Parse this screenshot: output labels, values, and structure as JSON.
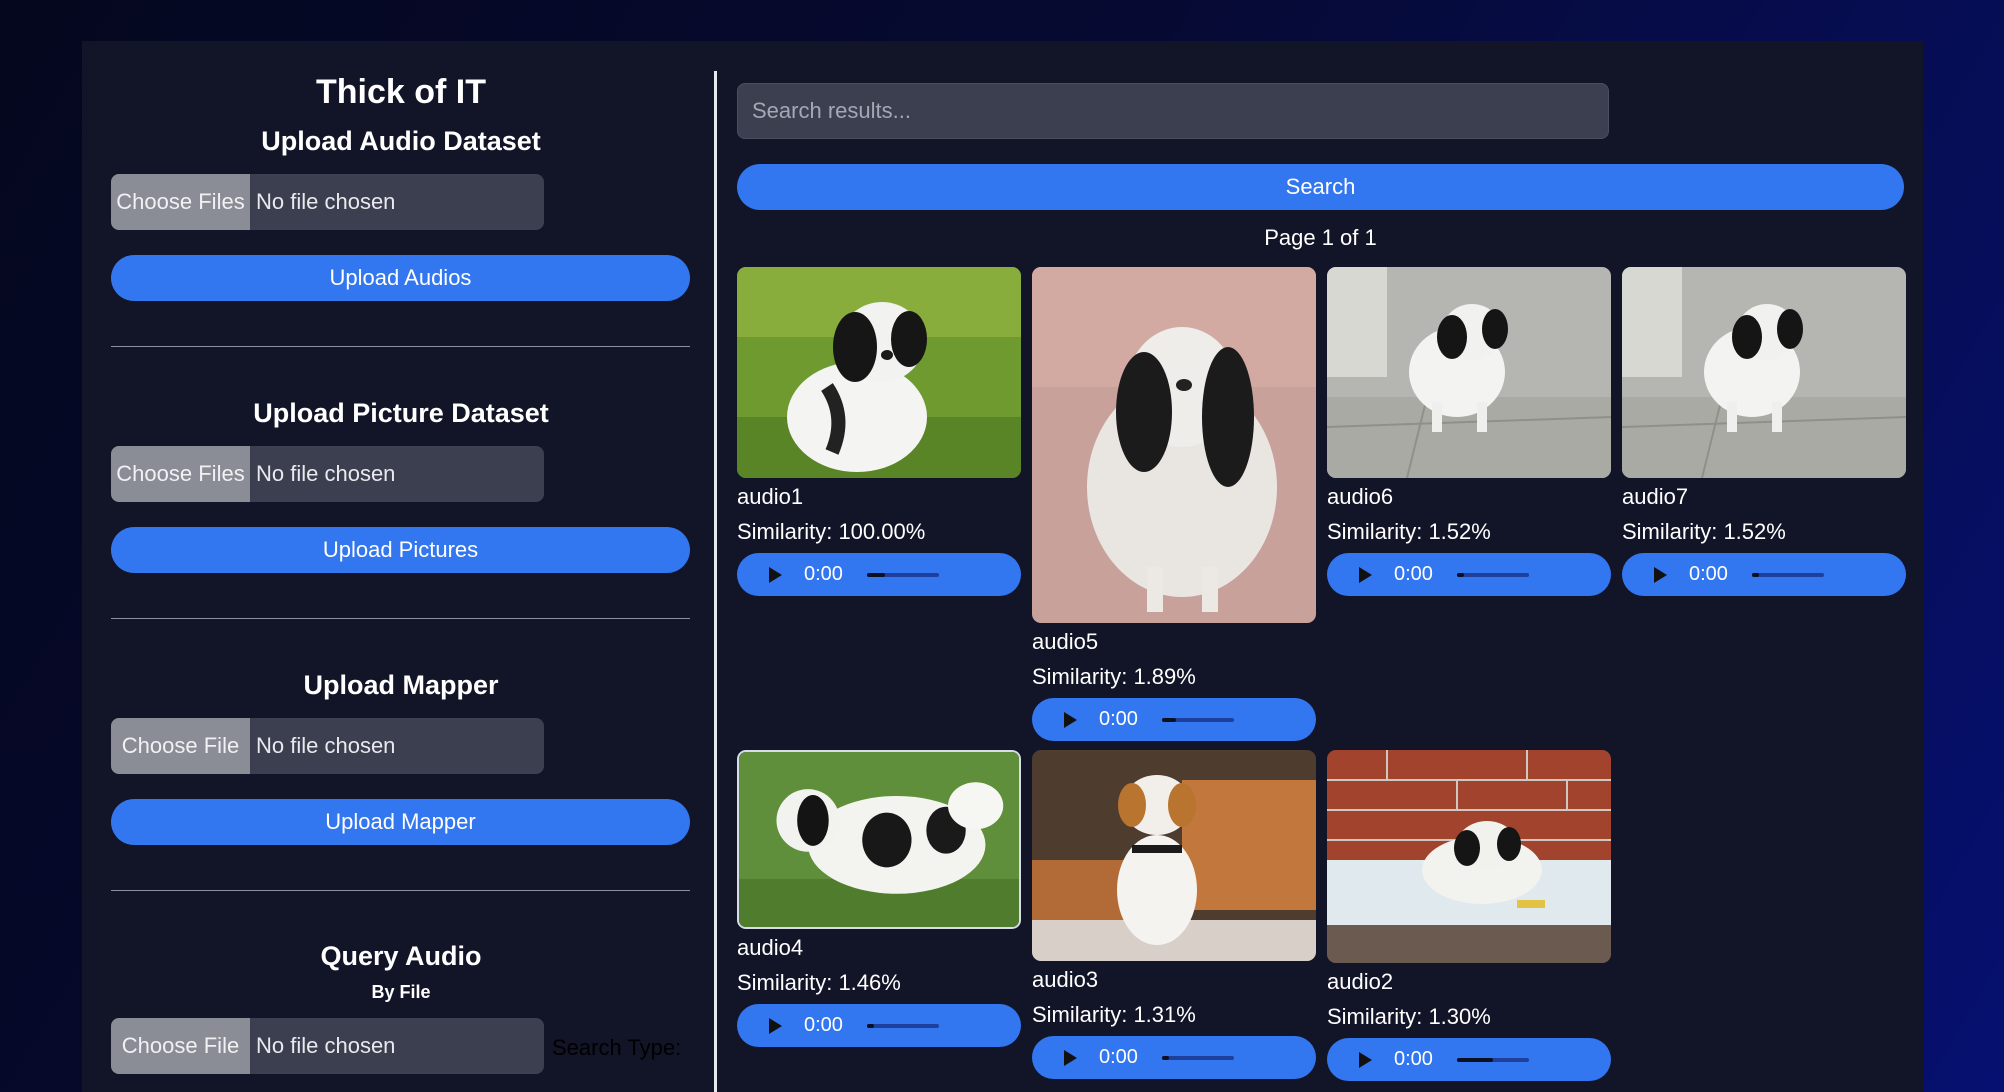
{
  "app": {
    "title": "Thick of IT"
  },
  "left_panel": {
    "audio_section": {
      "title": "Upload Audio Dataset",
      "choose_label": "Choose Files",
      "file_status": "No file chosen",
      "button_label": "Upload Audios"
    },
    "picture_section": {
      "title": "Upload Picture Dataset",
      "choose_label": "Choose Files",
      "file_status": "No file chosen",
      "button_label": "Upload Pictures"
    },
    "mapper_section": {
      "title": "Upload Mapper",
      "choose_label": "Choose File",
      "file_status": "No file chosen",
      "button_label": "Upload Mapper"
    },
    "query_section": {
      "title": "Query Audio",
      "subtitle": "By File",
      "choose_label": "Choose File",
      "file_status": "No file chosen",
      "search_type_label": "Search Type:"
    }
  },
  "search": {
    "placeholder": "Search results...",
    "button_label": "Search"
  },
  "pagination": {
    "label": "Page 1 of 1"
  },
  "results": [
    {
      "name": "audio1",
      "similarity": "Similarity: 100.00%",
      "time": "0:00",
      "progress": 0.25,
      "image": "dog-on-grass"
    },
    {
      "name": "audio5",
      "similarity": "Similarity: 1.89%",
      "time": "0:00",
      "progress": 0.2,
      "image": "long-haired-dog-standing"
    },
    {
      "name": "audio6",
      "similarity": "Similarity: 1.52%",
      "time": "0:00",
      "progress": 0.1,
      "image": "small-dog-on-tiles"
    },
    {
      "name": "audio7",
      "similarity": "Similarity: 1.52%",
      "time": "0:00",
      "progress": 0.1,
      "image": "small-dog-on-tiles"
    },
    {
      "name": "audio4",
      "similarity": "Similarity: 1.46%",
      "time": "0:00",
      "progress": 0.1,
      "image": "dog-side-view-grass"
    },
    {
      "name": "audio3",
      "similarity": "Similarity: 1.31%",
      "time": "0:00",
      "progress": 0.1,
      "image": "puppy-sitting-on-bed"
    },
    {
      "name": "audio2",
      "similarity": "Similarity: 1.30%",
      "time": "0:00",
      "progress": 0.5,
      "image": "dog-lying-on-blanket"
    }
  ]
}
